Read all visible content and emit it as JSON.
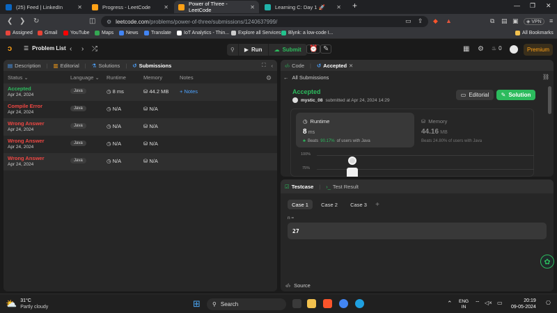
{
  "tabs": [
    {
      "title": "(25) Feed | LinkedIn",
      "fav_color": "#0a66c2"
    },
    {
      "title": "Progress - LeetCode",
      "fav_color": "#ffa116"
    },
    {
      "title": "Power of Three - LeetCode",
      "fav_color": "#ffa116"
    },
    {
      "title": "Learning C: Day 1 🚀",
      "fav_color": "#20b2aa"
    }
  ],
  "address": {
    "host": "leetcode.com",
    "path": "/problems/power-of-three/submissions/1240637999/"
  },
  "bookmarks": [
    "Assigned",
    "Gmail",
    "YouTube",
    "Maps",
    "News",
    "Translate",
    "IoT Analytics - Thin...",
    "Explore all Services",
    "Blynk: a low-code I...",
    "All Bookmarks"
  ],
  "lc_header": {
    "problem_list": "Problem List",
    "run": "Run",
    "submit": "Submit",
    "coins": "0",
    "premium": "Premium"
  },
  "left_tabs": [
    "Description",
    "Editorial",
    "Solutions",
    "Submissions"
  ],
  "table_headers": {
    "status": "Status",
    "language": "Language",
    "runtime": "Runtime",
    "memory": "Memory",
    "notes": "Notes"
  },
  "submissions": [
    {
      "status": "Accepted",
      "date": "Apr 24, 2024",
      "lang": "Java",
      "runtime": "8 ms",
      "memory": "44.2 MB",
      "notes": "+ Notes"
    },
    {
      "status": "Compile Error",
      "date": "Apr 24, 2024",
      "lang": "Java",
      "runtime": "N/A",
      "memory": "N/A",
      "notes": ""
    },
    {
      "status": "Wrong Answer",
      "date": "Apr 24, 2024",
      "lang": "Java",
      "runtime": "N/A",
      "memory": "N/A",
      "notes": ""
    },
    {
      "status": "Wrong Answer",
      "date": "Apr 24, 2024",
      "lang": "Java",
      "runtime": "N/A",
      "memory": "N/A",
      "notes": ""
    },
    {
      "status": "Wrong Answer",
      "date": "Apr 24, 2024",
      "lang": "Java",
      "runtime": "N/A",
      "memory": "N/A",
      "notes": ""
    }
  ],
  "right_tabs": {
    "code": "Code",
    "accepted": "Accepted"
  },
  "detail": {
    "back": "All Submissions",
    "status": "Accepted",
    "user": "mystic_08",
    "submitted": "submitted at Apr 24, 2024 14:29",
    "editorial": "Editorial",
    "solution": "Solution",
    "runtime_label": "Runtime",
    "runtime_value": "8",
    "runtime_unit": "ms",
    "runtime_beats": "Beats",
    "runtime_pct": "90.17%",
    "runtime_tail": "of users with Java",
    "memory_label": "Memory",
    "memory_value": "44.16",
    "memory_unit": "MB",
    "memory_beats": "Beats 24.80% of users with Java",
    "axis_100": "100%",
    "axis_75": "75%"
  },
  "bottom": {
    "testcase": "Testcase",
    "test_result": "Test Result",
    "cases": [
      "Case 1",
      "Case 2",
      "Case 3"
    ],
    "plus": "+",
    "var_label": "n =",
    "var_value": "27",
    "source": "Source"
  },
  "taskbar": {
    "temp": "31°C",
    "weather": "Partly cloudy",
    "search": "Search",
    "lang1": "ENG",
    "lang2": "IN",
    "time": "20:19",
    "date": "09-05-2024"
  },
  "colors": {
    "accepted": "#2cbb5d",
    "error": "#ef4743",
    "accent": "#ffa116",
    "link": "#4da3ff"
  }
}
